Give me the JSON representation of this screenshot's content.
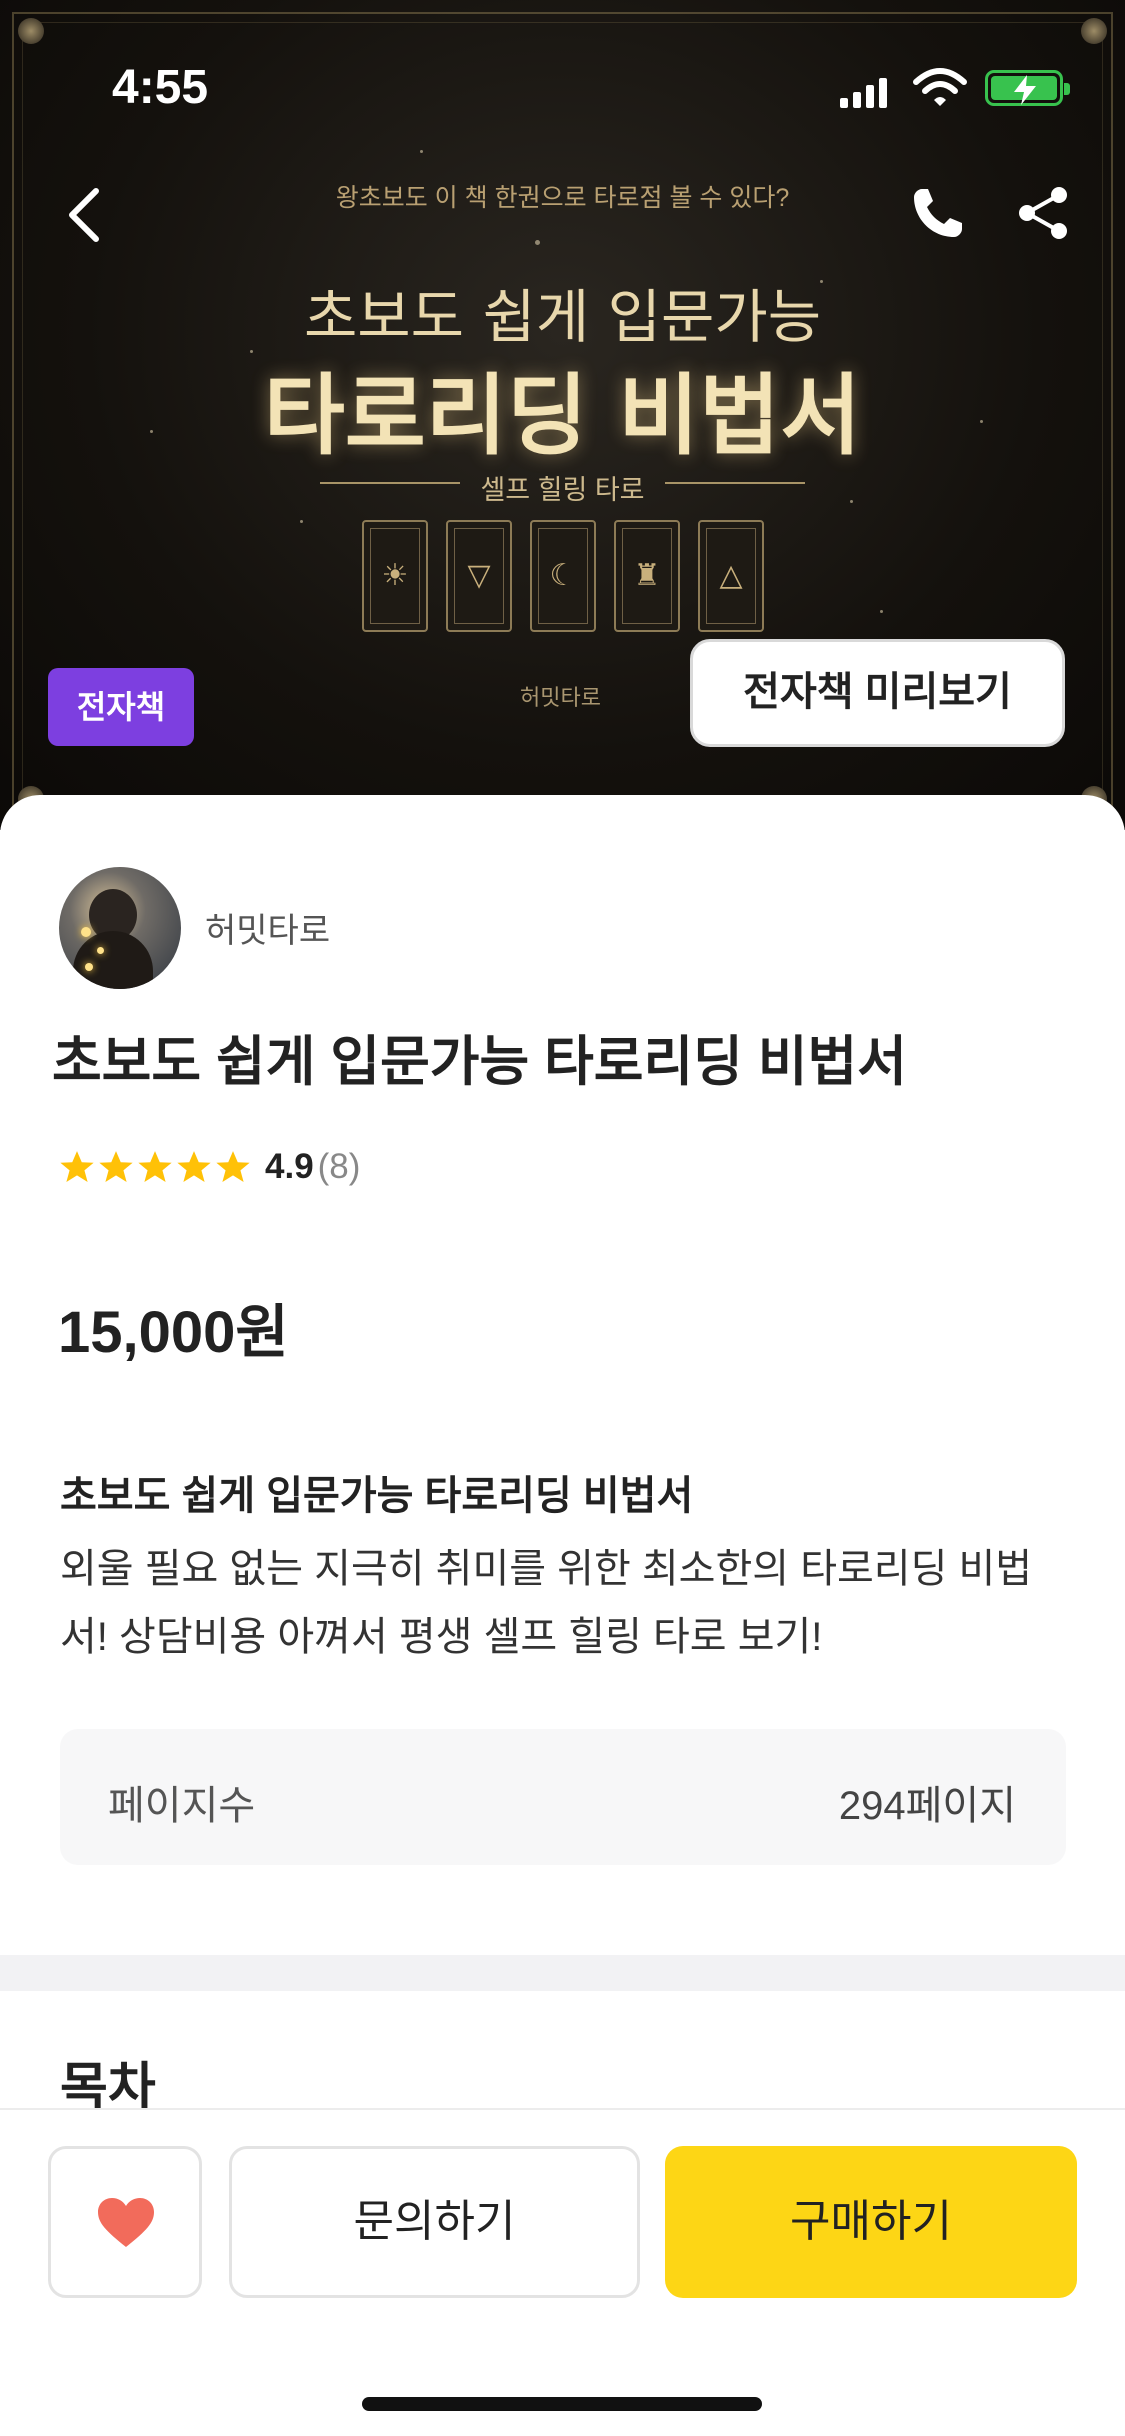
{
  "status_bar": {
    "time": "4:55"
  },
  "cover": {
    "subtitle": "왕초보도 이 책 한권으로 타로점 볼 수 있다?",
    "line1": "초보도 쉽게 입문가능",
    "line2": "타로리딩 비법서",
    "divider_text": "셀프 힐링 타로",
    "author": "허밋타로",
    "card_symbols": [
      "☀",
      "▽",
      "☾",
      "♜",
      "△"
    ]
  },
  "badge": "전자책",
  "preview_button": "전자책 미리보기",
  "author": {
    "name": "허밋타로"
  },
  "product": {
    "title": "초보도 쉽게 입문가능 타로리딩 비법서",
    "rating_score": "4.9",
    "rating_count": "(8)",
    "price": "15,000원",
    "desc_title": "초보도 쉽게 입문가능 타로리딩 비법서",
    "desc_body": "외울 필요 없는 지극히 취미를 위한 최소한의 타로리딩 비법서! 상담비용 아껴서 평생 셀프 힐링 타로 보기!",
    "spec_label": "페이지수",
    "spec_value": "294페이지"
  },
  "toc_heading": "목차",
  "actions": {
    "inquiry": "문의하기",
    "buy": "구매하기"
  },
  "colors": {
    "badge_purple": "#7d3fe0",
    "buy_yellow": "#fdd615",
    "heart_red": "#f26b5b",
    "star_yellow": "#ffc107"
  }
}
